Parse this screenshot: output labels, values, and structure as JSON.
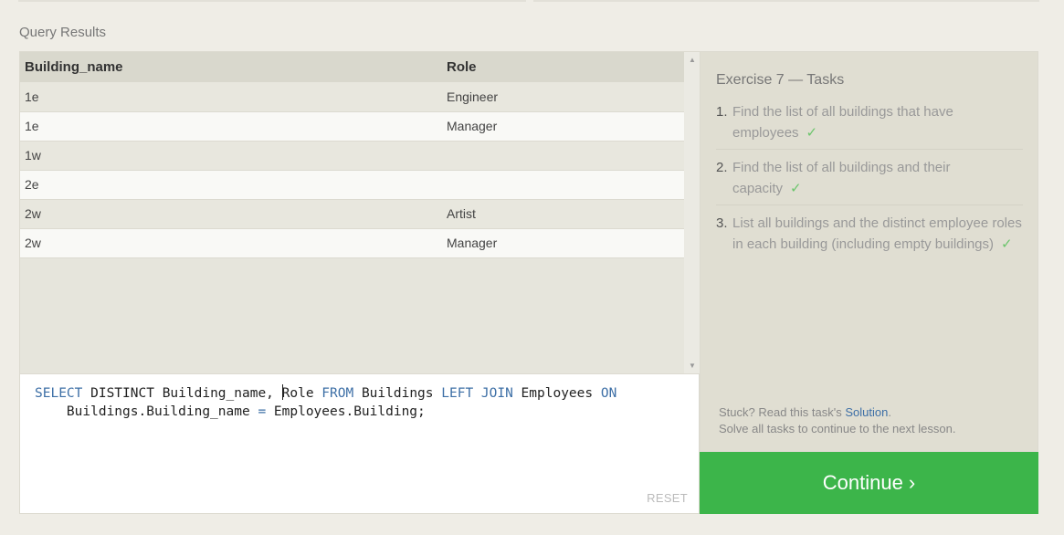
{
  "section_title": "Query Results",
  "results": {
    "columns": [
      "Building_name",
      "Role"
    ],
    "rows": [
      [
        "1e",
        "Engineer"
      ],
      [
        "1e",
        "Manager"
      ],
      [
        "1w",
        ""
      ],
      [
        "2e",
        ""
      ],
      [
        "2w",
        "Artist"
      ],
      [
        "2w",
        "Manager"
      ]
    ]
  },
  "scroll": {
    "up_glyph": "▲",
    "down_glyph": "▼"
  },
  "editor": {
    "line1": {
      "kw_select": "SELECT",
      "distinct_cols_a": " DISTINCT Building_name, ",
      "role": "Role",
      "kw_from": "FROM",
      "table_a": " Buildings ",
      "kw_left_join": "LEFT JOIN",
      "table_b": " Employees ",
      "kw_on": "ON"
    },
    "line2": {
      "left": "    Buildings.Building_name ",
      "eq": "=",
      "right": " Employees.Building;"
    },
    "reset_label": "RESET"
  },
  "tasks": {
    "title": "Exercise 7 — Tasks",
    "items": [
      {
        "num": "1.",
        "text": "Find the list of all buildings that have employees",
        "check": "✓"
      },
      {
        "num": "2.",
        "text": "Find the list of all buildings and their capacity",
        "check": "✓"
      },
      {
        "num": "3.",
        "text": "List all buildings and the distinct employee roles in each building (including empty buildings)",
        "check": "✓"
      }
    ],
    "stuck_prefix": "Stuck? Read this task's ",
    "solution_label": "Solution",
    "stuck_suffix": ".",
    "solve_note": "Solve all tasks to continue to the next lesson."
  },
  "continue_label": "Continue ›",
  "colors": {
    "accent_green": "#3cb54a",
    "keyword_blue": "#3d6fa6",
    "check_green": "#6cc56c"
  }
}
